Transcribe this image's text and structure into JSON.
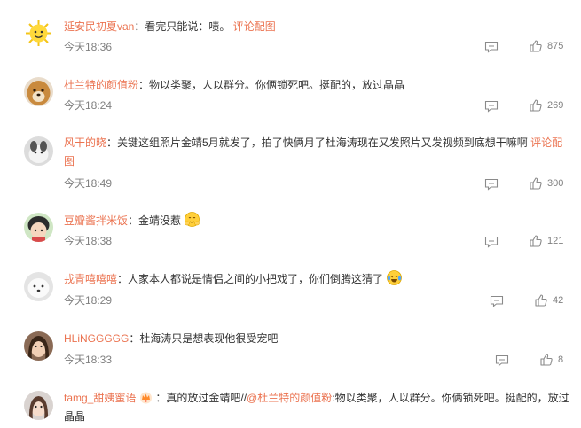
{
  "separator": "：",
  "comments": [
    {
      "user": "延安民初夏van",
      "text": "看完只能说：啧。",
      "link": "评论配图",
      "time": "今天18:36",
      "likes": "875"
    },
    {
      "user": "杜兰特的颜值粉",
      "text": "物以类聚，人以群分。你俩锁死吧。挺配的，放过晶晶",
      "time": "今天18:24",
      "likes": "269"
    },
    {
      "user": "风干的晓",
      "text": "关键这组照片金靖5月就发了，拍了快俩月了杜海涛现在又发照片又发视频到底想干嘛啊",
      "link": "评论配图",
      "time": "今天18:49",
      "likes": "300"
    },
    {
      "user": "豆瓣酱拌米饭",
      "text": "金靖没惹",
      "time": "今天18:38",
      "likes": "121"
    },
    {
      "user": "戎青嘻嘻嘻",
      "text": "人家本人都说是情侣之间的小把戏了，你们倒腾这猜了",
      "time": "今天18:29",
      "likes": "42"
    },
    {
      "user": "HLiNGGGGG",
      "text": "杜海涛只是想表现他很受宠吧",
      "time": "今天18:33",
      "likes": "8"
    },
    {
      "user": "tamg_甜姨蜜语",
      "text_prefix": "真的放过金靖吧//",
      "mention": "@杜兰特的颜值粉",
      "text": ":物以类聚，人以群分。你俩锁死吧。挺配的，放过晶晶"
    }
  ],
  "icons": {
    "reply": "reply-icon",
    "like": "thumbs-up-icon"
  },
  "colors": {
    "username": "#eb7350",
    "meta": "#808080",
    "text": "#333333"
  }
}
